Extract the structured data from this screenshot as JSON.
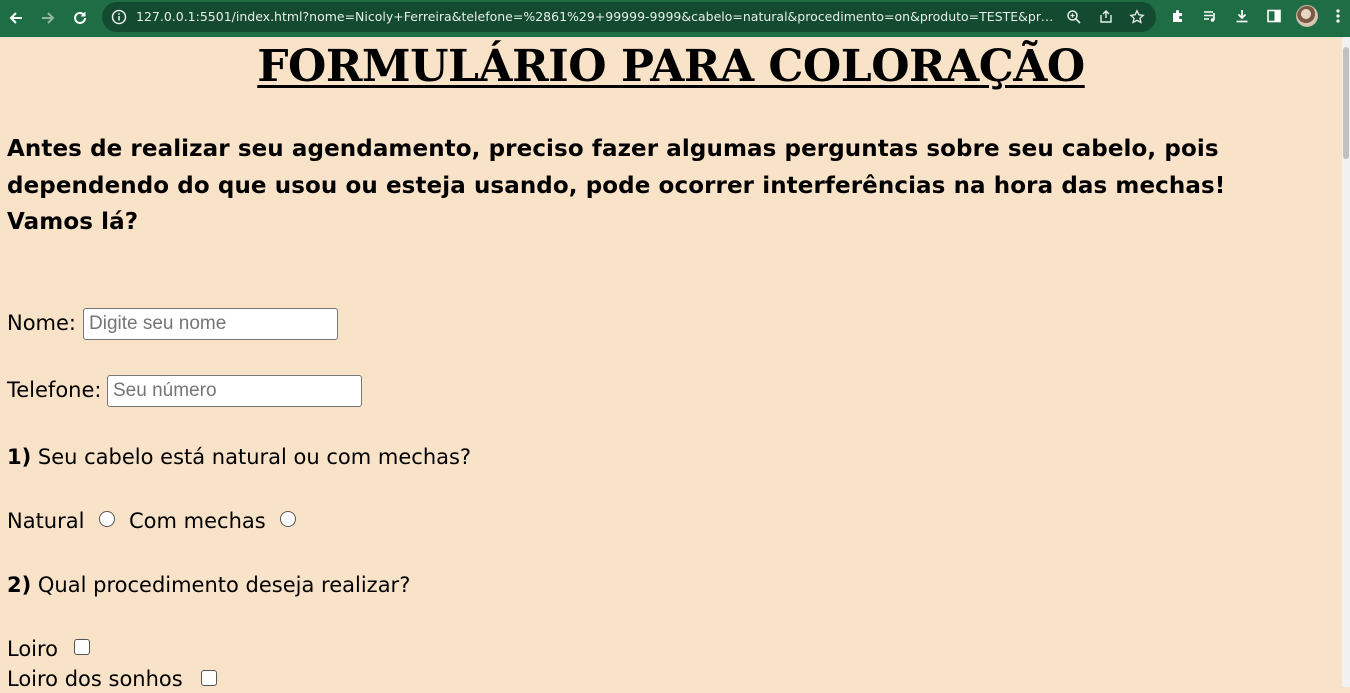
{
  "browser": {
    "url": "127.0.0.1:5501/index.html?nome=Nicoly+Ferreira&telefone=%2861%29+99999-9999&cabelo=natural&procedimento=on&produto=TESTE&prod..."
  },
  "page": {
    "title": "FORMULÁRIO PARA COLORAÇÃO",
    "intro": "Antes de realizar seu agendamento, preciso fazer algumas perguntas sobre seu cabelo, pois dependendo do que usou ou esteja usando, pode ocorrer interferências na hora das mechas! Vamos lá?",
    "nome": {
      "label": "Nome:",
      "placeholder": "Digite seu nome"
    },
    "telefone": {
      "label": "Telefone:",
      "placeholder": "Seu número"
    },
    "q1": {
      "number": "1)",
      "text": "Seu cabelo está natural ou com mechas?",
      "options": [
        "Natural",
        "Com mechas"
      ]
    },
    "q2": {
      "number": "2)",
      "text": "Qual procedimento deseja realizar?",
      "options": [
        "Loiro",
        "Loiro dos sonhos"
      ]
    }
  }
}
